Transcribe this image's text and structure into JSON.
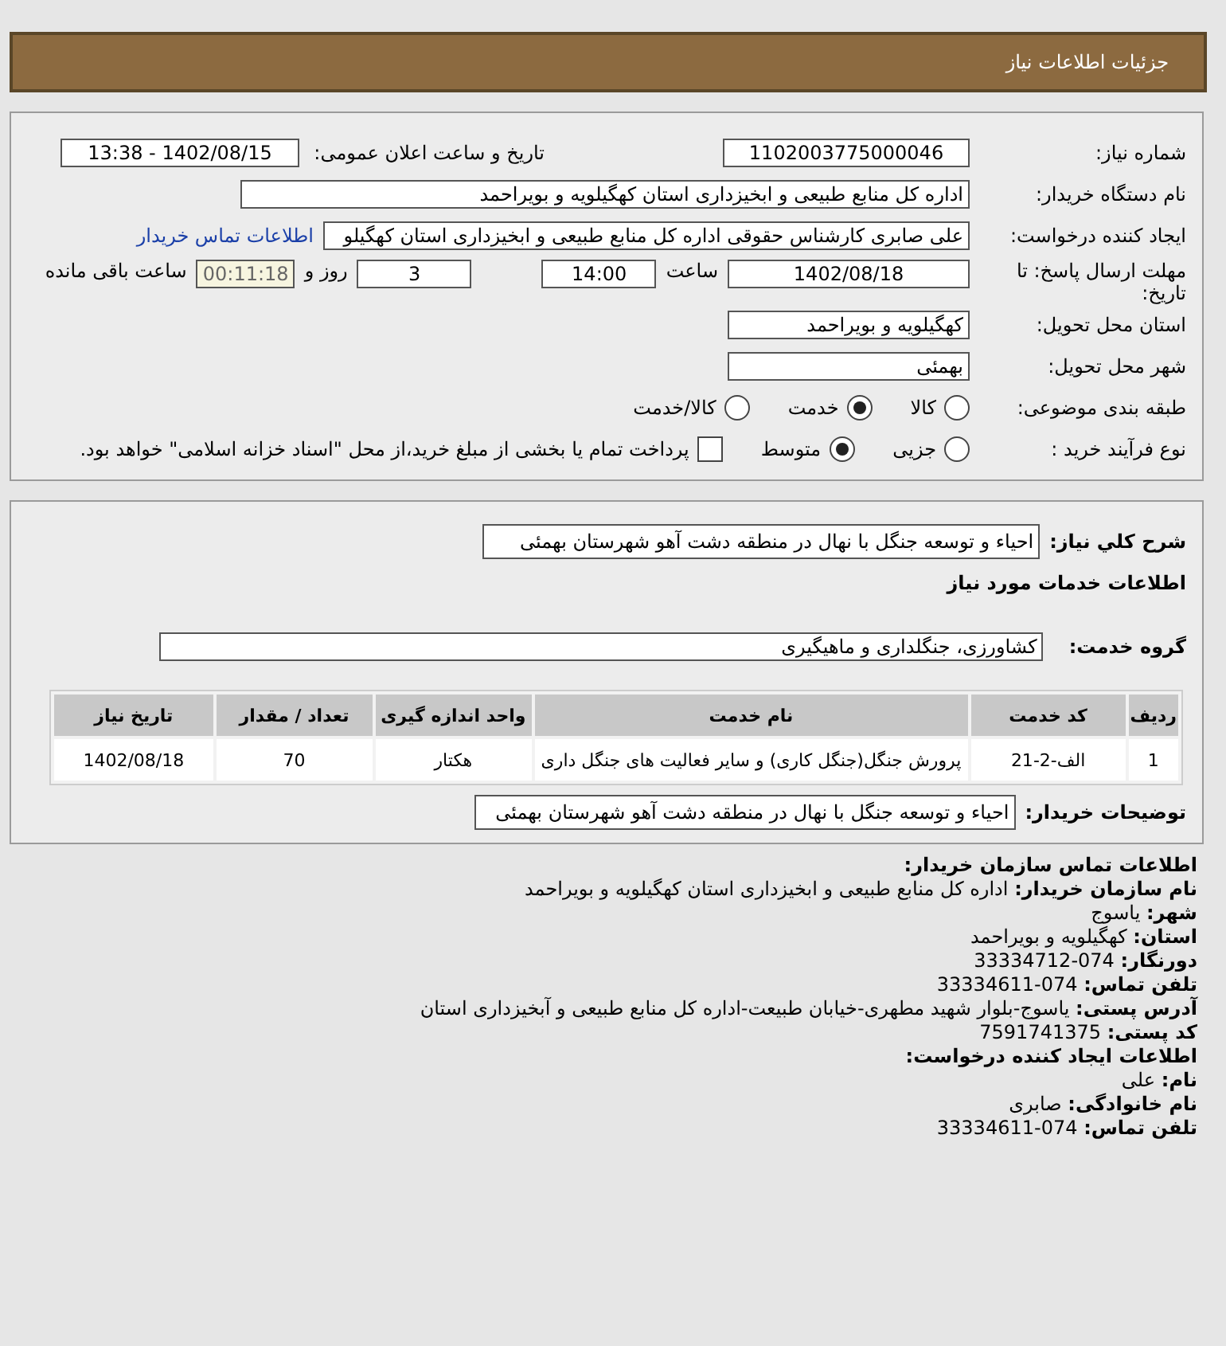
{
  "header": {
    "title": "جزئیات اطلاعات نیاز"
  },
  "details": {
    "need_number": {
      "label": "شماره نیاز:",
      "value": "1102003775000046"
    },
    "announce": {
      "label": "تاریخ و ساعت اعلان عمومی:",
      "value": "1402/08/15 - 13:38"
    },
    "buyer_org": {
      "label": "نام دستگاه خریدار:",
      "value": "اداره کل منابع طبیعی و ابخیزداری استان کهگیلویه و بویراحمد"
    },
    "creator": {
      "label": "ایجاد کننده درخواست:",
      "value": "علی صابری کارشناس حقوقی اداره کل منابع طبیعی و ابخیزداری استان کهگیلو",
      "link": "اطلاعات تماس خریدار"
    },
    "deadline": {
      "label": "مهلت ارسال پاسخ: تا تاریخ:",
      "date": "1402/08/18",
      "time_label": "ساعت",
      "time": "14:00",
      "days": "3",
      "days_label": "روز و",
      "remaining": "00:11:18",
      "remaining_label": "ساعت باقی مانده"
    },
    "province": {
      "label": "استان محل تحویل:",
      "value": "کهگیلویه و بویراحمد"
    },
    "city": {
      "label": "شهر محل تحویل:",
      "value": "بهمئی"
    },
    "category": {
      "label": "طبقه بندی موضوعی:",
      "options": [
        {
          "label": "کالا",
          "selected": false
        },
        {
          "label": "خدمت",
          "selected": true
        },
        {
          "label": "کالا/خدمت",
          "selected": false
        }
      ]
    },
    "process": {
      "label": "نوع فرآیند خرید :",
      "options": [
        {
          "label": "جزیی",
          "selected": false
        },
        {
          "label": "متوسط",
          "selected": true
        }
      ],
      "checkbox": {
        "checked": false,
        "text": "پرداخت تمام یا بخشی از مبلغ خرید،از محل \"اسناد خزانه اسلامی\" خواهد بود."
      }
    }
  },
  "summary": {
    "description": {
      "label": "شرح کلي نیاز:",
      "value": "احیاء و توسعه جنگل با نهال در منطقه دشت آهو شهرستان بهمئی"
    },
    "services_title": "اطلاعات خدمات مورد نیاز",
    "service_group": {
      "label": "گروه خدمت:",
      "value": "کشاورزی، جنگلداری و ماهیگیری"
    },
    "table": {
      "columns": [
        "ردیف",
        "کد خدمت",
        "نام خدمت",
        "واحد اندازه گیری",
        "تعداد / مقدار",
        "تاریخ نیاز"
      ],
      "rows": [
        [
          "1",
          "الف-2-21",
          "پرورش جنگل(جنگل کاری) و سایر فعالیت های جنگل داری",
          "هکتار",
          "70",
          "1402/08/18"
        ]
      ]
    },
    "buyer_notes": {
      "label": "توضیحات خریدار:",
      "value": "احیاء و توسعه جنگل با نهال در منطقه دشت آهو شهرستان بهمئی"
    }
  },
  "contact": [
    {
      "kind": "heading",
      "label": "اطلاعات تماس سازمان خریدار:"
    },
    {
      "kind": "field",
      "label": "نام سازمان خریدار:",
      "value": "اداره کل منابع طبیعی و ابخیزداری استان کهگیلویه و بویراحمد"
    },
    {
      "kind": "field",
      "label": "شهر:",
      "value": "یاسوج"
    },
    {
      "kind": "field",
      "label": "استان:",
      "value": "کهگیلویه و بویراحمد"
    },
    {
      "kind": "field",
      "label": "دورنگار:",
      "value": "074-33334712"
    },
    {
      "kind": "field",
      "label": "تلفن تماس:",
      "value": "074-33334611"
    },
    {
      "kind": "field",
      "label": "آدرس پستی:",
      "value": "یاسوج-بلوار شهید مطهری-خیابان طبیعت-اداره کل منابع طبیعی و آبخیزداری استان"
    },
    {
      "kind": "field",
      "label": "کد پستی:",
      "value": "7591741375"
    },
    {
      "kind": "heading",
      "label": "اطلاعات ایجاد کننده درخواست:"
    },
    {
      "kind": "field",
      "label": "نام:",
      "value": "علی"
    },
    {
      "kind": "field",
      "label": "نام خانوادگی:",
      "value": "صابری"
    },
    {
      "kind": "field",
      "label": "تلفن تماس:",
      "value": "074-33334611"
    }
  ]
}
